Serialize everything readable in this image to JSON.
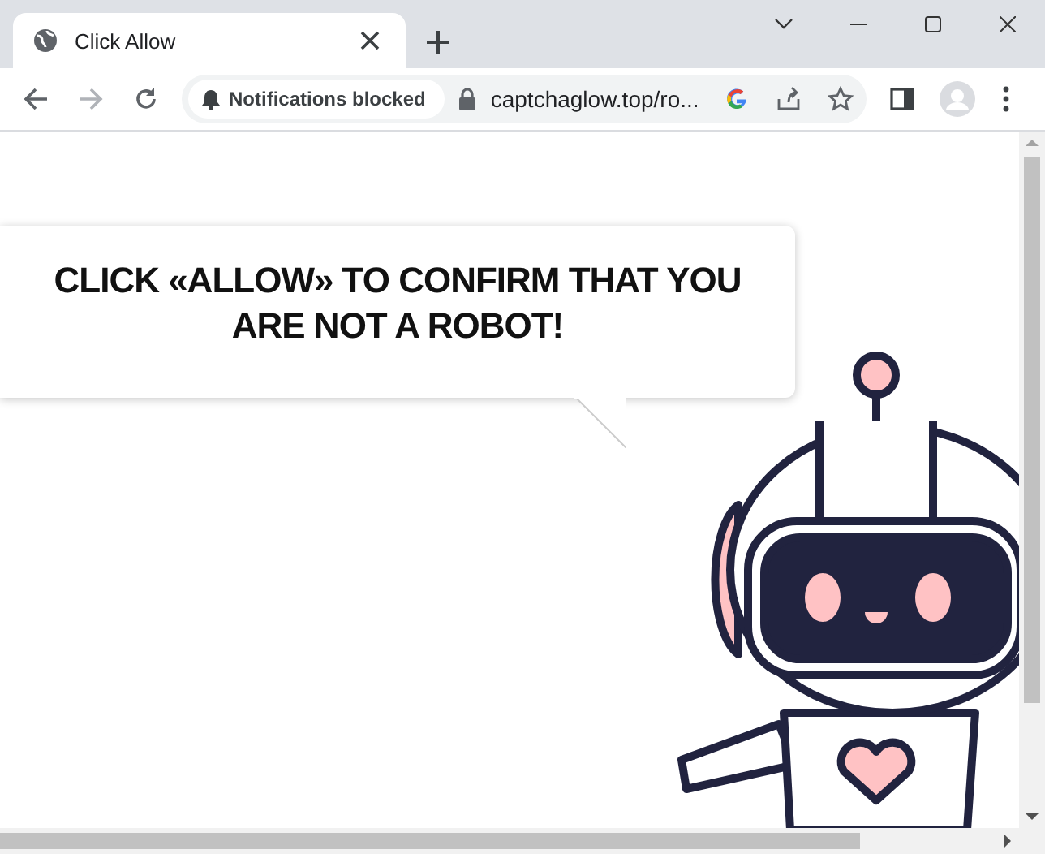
{
  "tab": {
    "title": "Click Allow"
  },
  "toolbar": {
    "back_disabled": false,
    "forward_disabled": true,
    "permission_chip": "Notifications blocked",
    "url": "captchaglow.top/ro..."
  },
  "page": {
    "message": "CLICK «ALLOW» TO CONFIRM THAT YOU ARE NOT A ROBOT!"
  }
}
